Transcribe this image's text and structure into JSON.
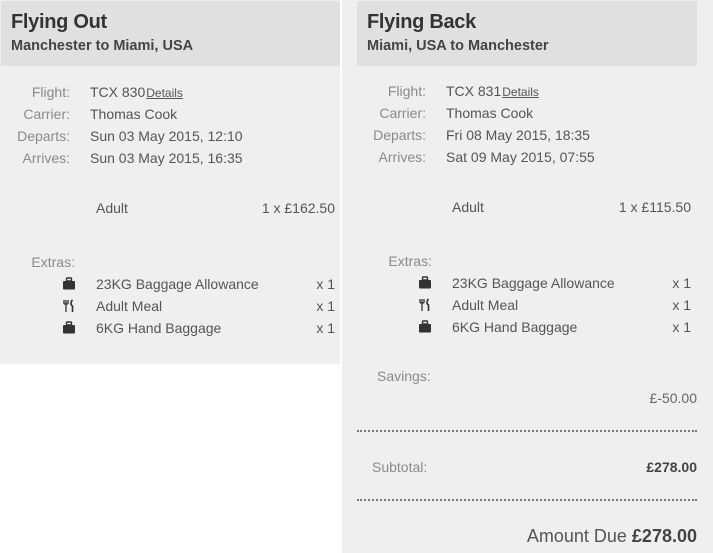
{
  "out": {
    "title": "Flying Out",
    "route": "Manchester to Miami, USA",
    "labels": {
      "flight": "Flight:",
      "carrier": "Carrier:",
      "departs": "Departs:",
      "arrives": "Arrives:",
      "extras": "Extras:"
    },
    "flight_number": "TCX 830",
    "details_label": "Details",
    "carrier": "Thomas Cook",
    "departs": "Sun 03 May 2015, 12:10",
    "arrives": "Sun 03 May 2015, 16:35",
    "passenger": {
      "type": "Adult",
      "price": "1 x £162.50"
    },
    "extras": [
      {
        "icon": "suitcase-icon",
        "label": "23KG Baggage Allowance",
        "qty": "x 1"
      },
      {
        "icon": "cutlery-icon",
        "label": "Adult Meal",
        "qty": "x 1"
      },
      {
        "icon": "suitcase-icon",
        "label": "6KG Hand Baggage",
        "qty": "x 1"
      }
    ]
  },
  "back": {
    "title": "Flying Back",
    "route": "Miami, USA to Manchester",
    "labels": {
      "flight": "Flight:",
      "carrier": "Carrier:",
      "departs": "Departs:",
      "arrives": "Arrives:",
      "extras": "Extras:"
    },
    "flight_number": "TCX 831",
    "details_label": "Details",
    "carrier": "Thomas Cook",
    "departs": "Fri 08 May 2015, 18:35",
    "arrives": "Sat 09 May 2015, 07:55",
    "passenger": {
      "type": "Adult",
      "price": "1 x £115.50"
    },
    "extras": [
      {
        "icon": "suitcase-icon",
        "label": "23KG Baggage Allowance",
        "qty": "x 1"
      },
      {
        "icon": "cutlery-icon",
        "label": "Adult Meal",
        "qty": "x 1"
      },
      {
        "icon": "suitcase-icon",
        "label": "6KG Hand Baggage",
        "qty": "x 1"
      }
    ]
  },
  "summary": {
    "savings_label": "Savings:",
    "savings_value": "£-50.00",
    "subtotal_label": "Subtotal:",
    "subtotal_value": "£278.00",
    "amount_due_label": "Amount Due",
    "amount_due_value": "£278.00"
  }
}
